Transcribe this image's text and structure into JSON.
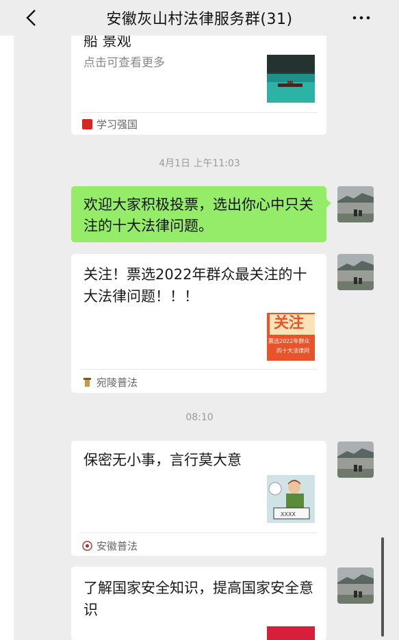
{
  "header": {
    "title": "安徽灰山村法律服务群(31)",
    "back_icon": "chevron-left-icon",
    "more_icon": "more-dots-icon"
  },
  "messages": [
    {
      "kind": "card",
      "title_fragment": "船 景观",
      "desc": "点击可查看更多",
      "source": "学习强国",
      "source_icon": "xuexi-qiangguo-logo"
    },
    {
      "kind": "time",
      "text": "4月1日 上午11:03"
    },
    {
      "kind": "text",
      "text": "欢迎大家积极投票，选出你心中只关注的十大法律问题。",
      "bubble_color": "#95ec69"
    },
    {
      "kind": "card",
      "title": "关注！票选2022年群众最关注的十大法律问题！！！",
      "thumb_big": "关注",
      "thumb_line1": "票选2022年群众",
      "thumb_line2": "的十大法律问",
      "source": "宛陵普法",
      "source_icon": "wanling-pufa-logo"
    },
    {
      "kind": "time",
      "text": "08:10"
    },
    {
      "kind": "card",
      "title": "保密无小事，言行莫大意",
      "thumb_label": "XXXX",
      "source": "安徽普法",
      "source_icon": "anhui-pufa-logo"
    },
    {
      "kind": "card",
      "title": "了解国家安全知识，提高国家安全意识"
    }
  ]
}
